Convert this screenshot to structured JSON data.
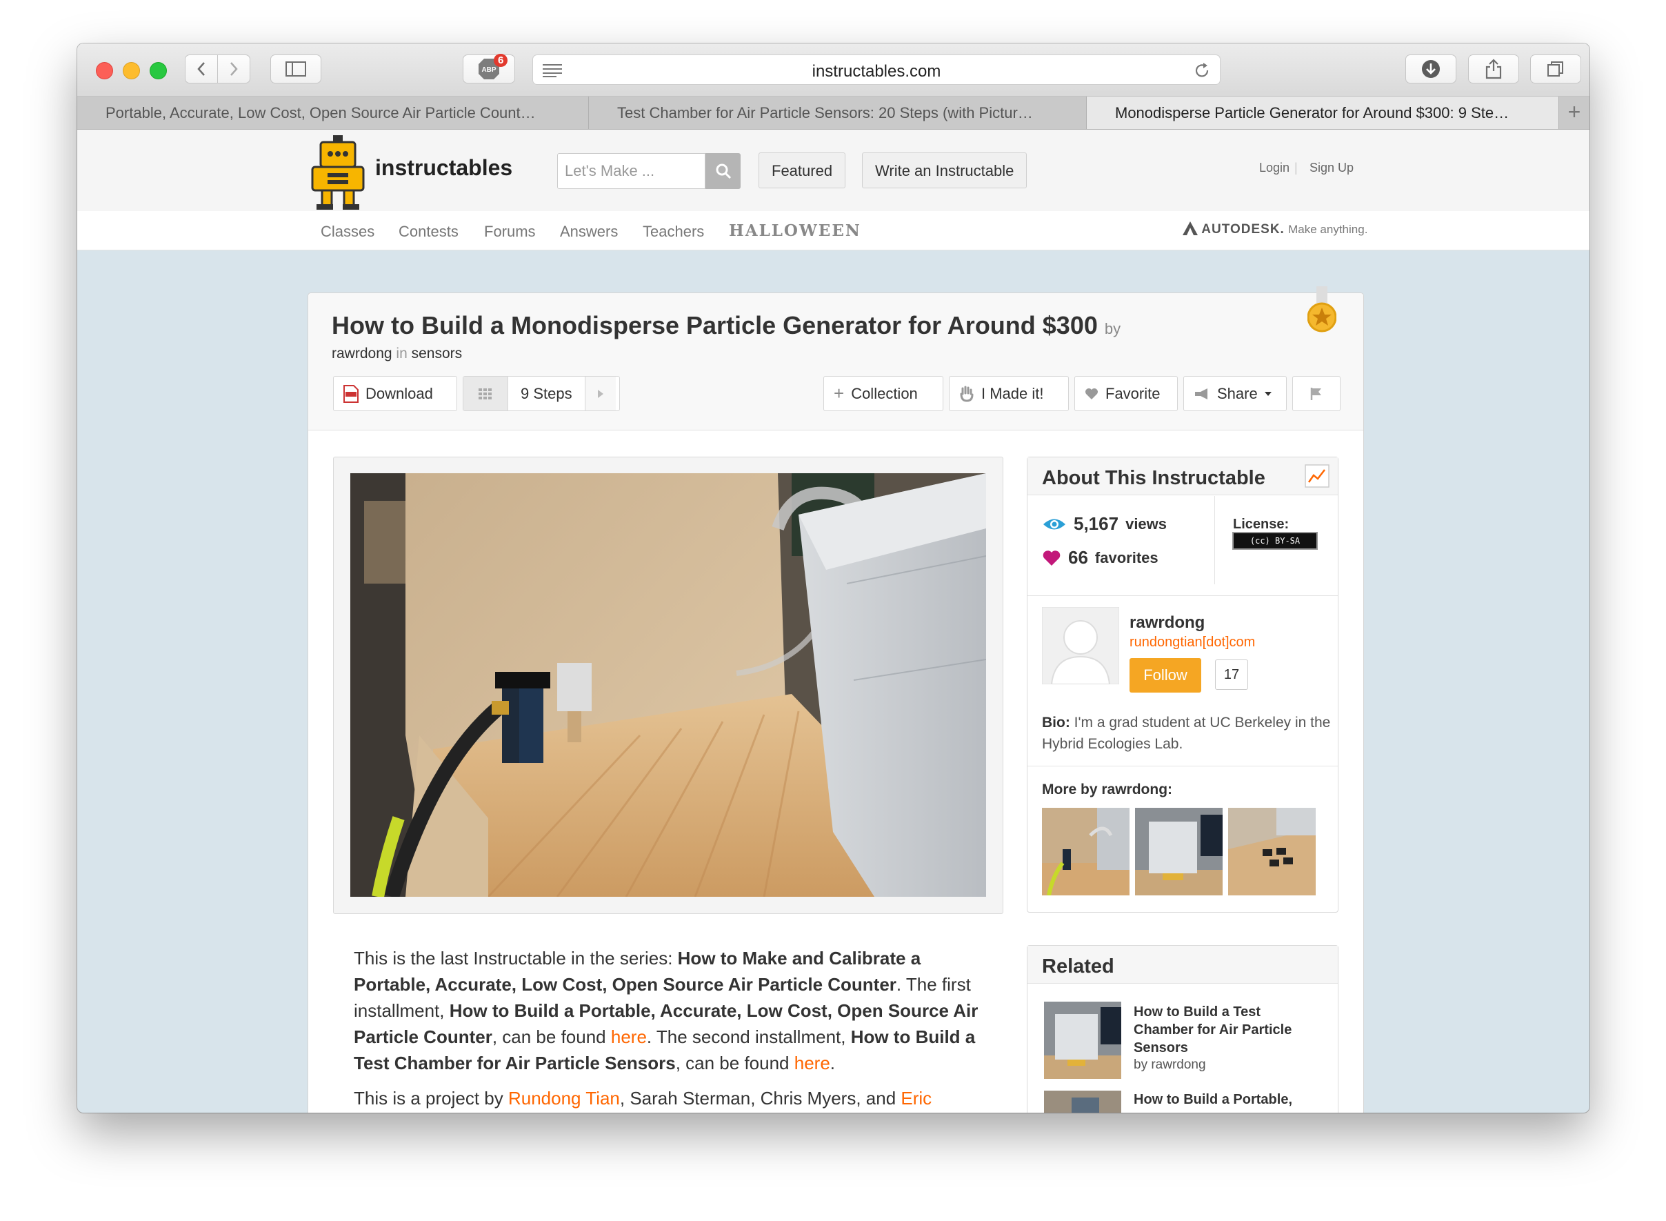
{
  "browser": {
    "url": "instructables.com",
    "adblock_badge": "6",
    "tabs": [
      {
        "label": "Portable, Accurate, Low Cost, Open Source Air Particle Count…"
      },
      {
        "label": "Test Chamber for Air Particle Sensors: 20 Steps (with Pictur…"
      },
      {
        "label": "Monodisperse Particle Generator for Around $300: 9 Ste…"
      }
    ]
  },
  "header": {
    "brand": "instructables",
    "search_placeholder": "Let's Make ...",
    "featured_label": "Featured",
    "write_label": "Write an Instructable",
    "login_label": "Login",
    "signup_label": "Sign Up",
    "nav": [
      "Classes",
      "Contests",
      "Forums",
      "Answers",
      "Teachers",
      "HALLOWEEN"
    ],
    "autodesk_brand": "AUTODESK.",
    "autodesk_tagline": "Make anything."
  },
  "article": {
    "title": "How to Build a Monodisperse Particle Generator for Around $300",
    "by": "by",
    "author": "rawrdong",
    "in_word": "in",
    "category": "sensors",
    "actions": {
      "download": "Download",
      "steps": "9 Steps",
      "collection": "Collection",
      "made_it": "I Made it!",
      "favorite": "Favorite",
      "share": "Share"
    },
    "body": {
      "p1_a": "This is the last Instructable in the series: ",
      "p1_b": "How to Make and Calibrate a Portable, Accurate, Low Cost, Open Source Air Particle Counter",
      "p1_c": ". The first installment, ",
      "p1_d": "How to Build a Portable, Accurate, Low Cost, Open Source Air Particle Counter",
      "p1_e": ", can be found ",
      "p1_f": "here",
      "p1_g": ". The second installment, ",
      "p1_h": "How to Build a Test Chamber for Air Particle Sensors",
      "p1_i": ", can be found ",
      "p1_j": "here",
      "p1_k": ".",
      "p2_a": "This is a project by ",
      "p2_b": "Rundong Tian",
      "p2_c": ", Sarah Sterman, Chris Myers, and ",
      "p2_d": "Eric"
    }
  },
  "sidebar": {
    "about_title": "About This Instructable",
    "views_count": "5,167",
    "views_label": "views",
    "favorites_count": "66",
    "favorites_label": "favorites",
    "license_label": "License:",
    "license_badge": "(cc) BY-SA",
    "author_name": "rawrdong",
    "author_email": "rundongtian[dot]com",
    "follow_label": "Follow",
    "follow_count": "17",
    "bio_label": "Bio:",
    "bio_text": " I'm a grad student at UC Berkeley in the Hybrid Ecologies Lab.",
    "more_by": "More by rawrdong:",
    "related_title": "Related",
    "related": [
      {
        "title": "How to Build a Test Chamber for Air Particle Sensors",
        "by": "by rawrdong"
      },
      {
        "title": "How to Build a Portable,",
        "by": ""
      }
    ]
  },
  "colors": {
    "accent_orange": "#ff6600",
    "follow_button": "#f5a623",
    "page_background": "#d8e4eb"
  }
}
